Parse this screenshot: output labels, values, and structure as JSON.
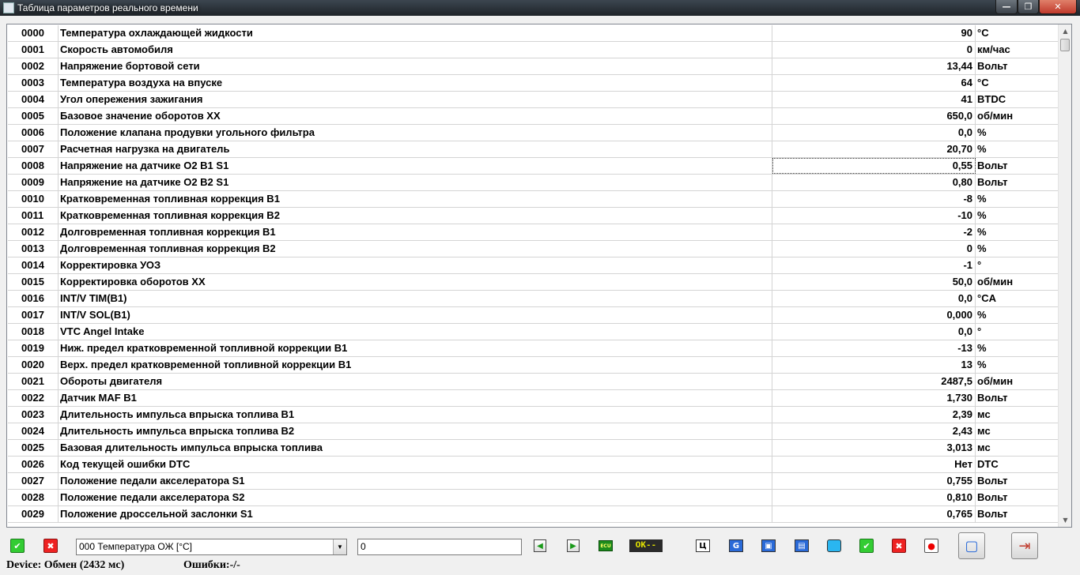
{
  "window": {
    "title": "Таблица параметров реального времени",
    "minimize": "—",
    "maximize": "❐",
    "close": "✕"
  },
  "table": {
    "rows": [
      {
        "code": "0000",
        "name": "Температура охлаждающей жидкости",
        "value": "90",
        "unit": "°C"
      },
      {
        "code": "0001",
        "name": "Скорость автомобиля",
        "value": "0",
        "unit": "км/час"
      },
      {
        "code": "0002",
        "name": "Напряжение бортовой сети",
        "value": "13,44",
        "unit": "Вольт"
      },
      {
        "code": "0003",
        "name": "Температура воздуха на впуске",
        "value": "64",
        "unit": "°C"
      },
      {
        "code": "0004",
        "name": "Угол опережения зажигания",
        "value": "41",
        "unit": "BTDC"
      },
      {
        "code": "0005",
        "name": "Базовое значение оборотов XX",
        "value": "650,0",
        "unit": "об/мин"
      },
      {
        "code": "0006",
        "name": "Положение клапана продувки угольного фильтра",
        "value": "0,0",
        "unit": "%"
      },
      {
        "code": "0007",
        "name": "Расчетная нагрузка на двигатель",
        "value": "20,70",
        "unit": "%"
      },
      {
        "code": "0008",
        "name": "Напряжение на датчике O2 B1 S1",
        "value": "0,55",
        "unit": "Вольт"
      },
      {
        "code": "0009",
        "name": "Напряжение на датчике O2 B2 S1",
        "value": "0,80",
        "unit": "Вольт"
      },
      {
        "code": "0010",
        "name": "Кратковременная топливная коррекция B1",
        "value": "-8",
        "unit": "%"
      },
      {
        "code": "0011",
        "name": "Кратковременная топливная коррекция B2",
        "value": "-10",
        "unit": "%"
      },
      {
        "code": "0012",
        "name": "Долговременная топливная коррекция B1",
        "value": "-2",
        "unit": "%"
      },
      {
        "code": "0013",
        "name": "Долговременная топливная коррекция B2",
        "value": "0",
        "unit": "%"
      },
      {
        "code": "0014",
        "name": "Корректировка УОЗ",
        "value": "-1",
        "unit": "°"
      },
      {
        "code": "0015",
        "name": "Корректировка оборотов XX",
        "value": "50,0",
        "unit": "об/мин"
      },
      {
        "code": "0016",
        "name": "INT/V TIM(B1)",
        "value": "0,0",
        "unit": "°CA"
      },
      {
        "code": "0017",
        "name": "INT/V SOL(B1)",
        "value": "0,000",
        "unit": "%"
      },
      {
        "code": "0018",
        "name": "VTC Angel Intake",
        "value": "0,0",
        "unit": "°"
      },
      {
        "code": "0019",
        "name": "Ниж. предел кратковременной топливной коррекции B1",
        "value": "-13",
        "unit": "%"
      },
      {
        "code": "0020",
        "name": "Верх. предел кратковременной топливной коррекции B1",
        "value": "13",
        "unit": "%"
      },
      {
        "code": "0021",
        "name": "Обороты двигателя",
        "value": "2487,5",
        "unit": "об/мин"
      },
      {
        "code": "0022",
        "name": "Датчик MAF B1",
        "value": "1,730",
        "unit": "Вольт"
      },
      {
        "code": "0023",
        "name": "Длительность импульса впрыска топлива B1",
        "value": "2,39",
        "unit": "мс"
      },
      {
        "code": "0024",
        "name": "Длительность импульса впрыска топлива B2",
        "value": "2,43",
        "unit": "мс"
      },
      {
        "code": "0025",
        "name": "Базовая длительность импульса впрыска топлива",
        "value": "3,013",
        "unit": "мс"
      },
      {
        "code": "0026",
        "name": "Код текущей ошибки DTC",
        "value": "Нет",
        "unit": "DTC"
      },
      {
        "code": "0027",
        "name": "Положение педали акселератора S1",
        "value": "0,755",
        "unit": "Вольт"
      },
      {
        "code": "0028",
        "name": "Положение педали акселератора S2",
        "value": "0,810",
        "unit": "Вольт"
      },
      {
        "code": "0029",
        "name": "Положение дроссельной заслонки S1",
        "value": "0,765",
        "unit": "Вольт"
      }
    ],
    "focused_row": "0008"
  },
  "toolbar": {
    "accept_icon": "✔",
    "reject_icon": "✖",
    "param_select_value": "000 Температура ОЖ [°C]",
    "param_input_value": "0",
    "prev_icon": "◀",
    "next_icon": "▶",
    "ecu_label": "ECU",
    "ok_label": "OK--",
    "ts_label": "Ц",
    "g_label": "G",
    "btn_a": "▣",
    "btn_b": "▤",
    "btn_c": " ",
    "save_icon": "▢",
    "exit_icon": "⇥"
  },
  "status": {
    "device": "Device: Обмен (2432 мс)",
    "errors": "Ошибки:-/-"
  }
}
